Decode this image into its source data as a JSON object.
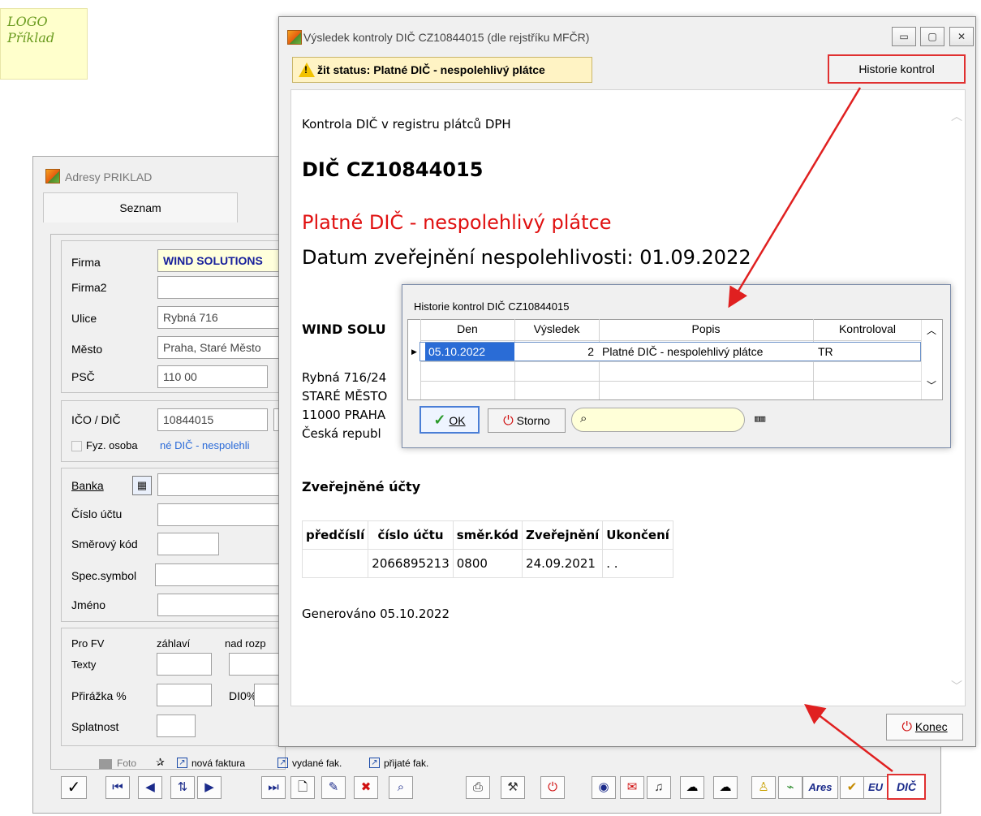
{
  "logo": {
    "line1": "LOGO",
    "line2": "Příklad"
  },
  "adresy": {
    "title": "Adresy PRIKLAD",
    "tab": "Seznam",
    "fields": {
      "firma": {
        "label": "Firma",
        "value": "WIND SOLUTIONS"
      },
      "firma2": {
        "label": "Firma2",
        "value": ""
      },
      "ulice": {
        "label": "Ulice",
        "value": "Rybná 716"
      },
      "mesto": {
        "label": "Město",
        "value": "Praha, Staré Město"
      },
      "psc": {
        "label": "PSČ",
        "value": "110 00"
      },
      "ico": {
        "label": "IČO / DIČ",
        "value": "10844015"
      },
      "fyz": {
        "label": "Fyz. osoba",
        "status": "né DIČ - nespolehli"
      },
      "banka": {
        "label": "Banka"
      },
      "cislo_uctu": {
        "label": "Číslo účtu"
      },
      "smerovy_kod": {
        "label": "Směrový kód"
      },
      "spec_symbol": {
        "label": "Spec.symbol"
      },
      "jmeno": {
        "label": "Jméno"
      },
      "pro_fv": {
        "label": "Pro FV",
        "zahlavi": "záhlaví",
        "nad": "nad rozp"
      },
      "texty": {
        "label": "Texty"
      },
      "prirazka": {
        "label": "Přirážka %",
        "dio": "DI0%"
      },
      "splatnost": {
        "label": "Splatnost"
      }
    },
    "links": {
      "foto": "Foto",
      "nova": "nová faktura",
      "vydane": "vydané fak.",
      "prijate": "přijaté fak."
    },
    "toolbar": {
      "ares": "Ares",
      "eu": "EU",
      "dic": "DIČ"
    }
  },
  "dic_window": {
    "title": "Výsledek kontroly DIČ CZ10844015 (dle rejstříku MFČR)",
    "status": "žit status: Platné DIČ - nespolehlivý plátce",
    "history_button": "Historie kontrol",
    "content": {
      "intro": "Kontrola DIČ v registru plátců DPH",
      "dic": "DIČ CZ10844015",
      "result": "Platné DIČ - nespolehlivý plátce",
      "date_line": "Datum zveřejnění nespolehlivosti: 01.09.2022",
      "company": "WIND SOLU",
      "address": [
        "Rybná 716/24",
        "STARÉ MĚSTO",
        "11000 PRAHA",
        "Česká republ"
      ],
      "accounts_title": "Zveřejněné účty",
      "accounts_headers": [
        "předčíslí",
        "číslo účtu",
        "směr.kód",
        "Zveřejnění",
        "Ukončení"
      ],
      "accounts_rows": [
        [
          "",
          "2066895213",
          "0800",
          "24.09.2021",
          ". ."
        ]
      ],
      "generated": "Generováno 05.10.2022"
    },
    "konec": "Konec",
    "colors": {
      "result": "#e01010",
      "highlight_border": "#e03030"
    }
  },
  "history_dialog": {
    "title": "Historie kontrol DIČ CZ10844015",
    "headers": [
      "Den",
      "Výsledek",
      "Popis",
      "Kontroloval"
    ],
    "row": {
      "den": "05.10.2022",
      "vysledek": "2",
      "popis": "Platné DIČ - nespolehlivý plátce",
      "kontroloval": "TR"
    },
    "ok": "OK",
    "storno": "Storno"
  }
}
